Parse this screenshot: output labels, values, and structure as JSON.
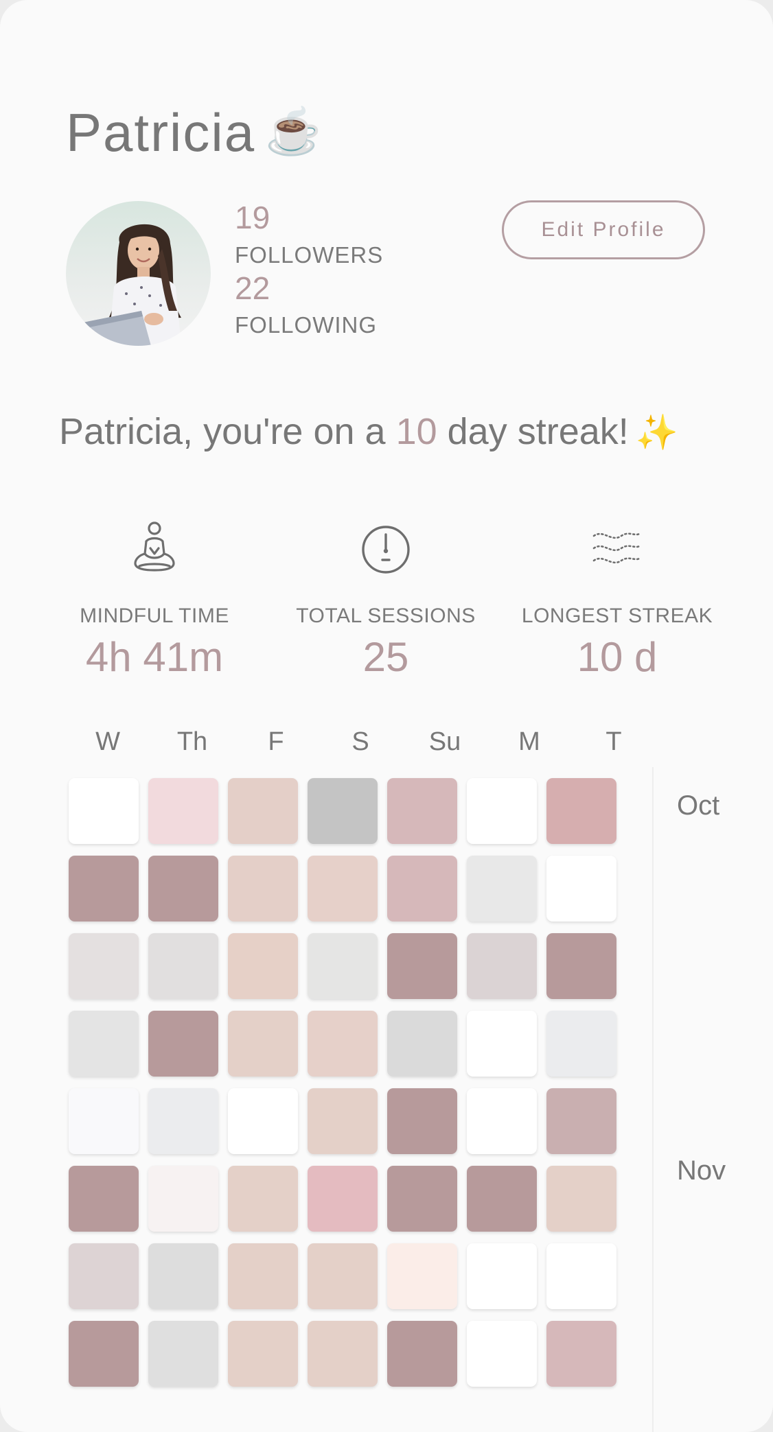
{
  "profile": {
    "name": "Patricia",
    "name_emoji": "☕",
    "followers_count": "19",
    "followers_label": "FOLLOWERS",
    "following_count": "22",
    "following_label": "FOLLOWING",
    "edit_button": "Edit Profile"
  },
  "streak": {
    "prefix": "Patricia, you're on a ",
    "days": "10",
    "suffix": " day streak!",
    "emoji": "✨"
  },
  "metrics": [
    {
      "icon": "meditation-icon",
      "label": "MINDFUL TIME",
      "value": "4h 41m"
    },
    {
      "icon": "clock-icon",
      "label": "TOTAL SESSIONS",
      "value": "25"
    },
    {
      "icon": "waves-icon",
      "label": "LONGEST STREAK",
      "value": "10 d"
    }
  ],
  "calendar": {
    "days": [
      "W",
      "Th",
      "F",
      "S",
      "Su",
      "M",
      "T"
    ],
    "months": [
      "Oct",
      "Nov"
    ],
    "rows": [
      [
        "#ffffff",
        "#f2dadd",
        "#e4cfc8",
        "#c4c4c4",
        "#d6b8ba",
        "#ffffff",
        "#d6aeaf"
      ],
      [
        "#b79a9b",
        "#b79a9b",
        "#e4cfc8",
        "#e6d0c9",
        "#d6b8ba",
        "#e8e8e8",
        "#ffffff"
      ],
      [
        "#e4e0e0",
        "#e1dfdf",
        "#e6d0c7",
        "#e5e5e4",
        "#b79a9b",
        "#dbd3d4",
        "#b79a9b"
      ],
      [
        "#e4e4e4",
        "#b79a9b",
        "#e4d0c8",
        "#e6d0c9",
        "#dadada",
        "#ffffff",
        "#ebecee"
      ],
      [
        "#f9f9fb",
        "#ebecee",
        "#ffffff",
        "#e4d0c8",
        "#b79a9b",
        "#ffffff",
        "#c9afb0"
      ],
      [
        "#b79a9b",
        "#f7f2f2",
        "#e4d0c8",
        "#e4bbc0",
        "#b79a9b",
        "#b79a9b",
        "#e4d0c8"
      ],
      [
        "#ddd3d4",
        "#dddddd",
        "#e4d0c8",
        "#e4d0c8",
        "#fbede8",
        "#ffffff",
        "#ffffff"
      ],
      [
        "#b79a9b",
        "#dfdfdf",
        "#e4d0c8",
        "#e4d0c8",
        "#b79a9b",
        "#ffffff",
        "#d6b8ba"
      ]
    ]
  },
  "colors": {
    "accent": "#b39a9d",
    "text": "#777777",
    "background": "#fafafa"
  }
}
